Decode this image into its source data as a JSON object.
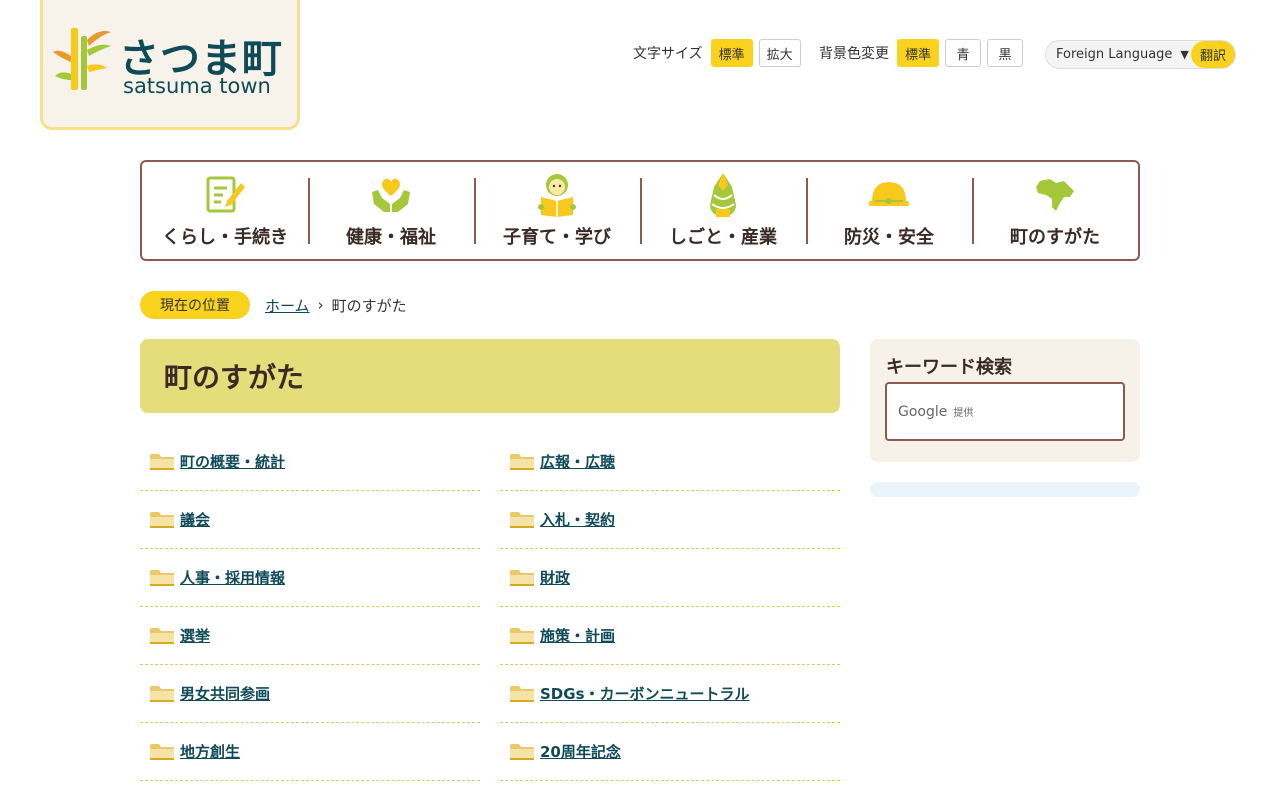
{
  "logo": {
    "ja": "さつま町",
    "en": "satsuma town"
  },
  "utility": {
    "font_size_label": "文字サイズ",
    "font_size_standard": "標準",
    "font_size_large": "拡大",
    "bg_label": "背景色変更",
    "bg_standard": "標準",
    "bg_blue": "青",
    "bg_black": "黒",
    "language_select": "Foreign Language",
    "translate_button": "翻訳"
  },
  "nav": [
    {
      "label": "くらし・手続き",
      "icon": "document-pen-icon"
    },
    {
      "label": "健康・福祉",
      "icon": "heart-hands-icon"
    },
    {
      "label": "子育て・学び",
      "icon": "child-book-icon"
    },
    {
      "label": "しごと・産業",
      "icon": "bamboo-shoot-icon"
    },
    {
      "label": "防災・安全",
      "icon": "helmet-icon"
    },
    {
      "label": "町のすがた",
      "icon": "town-map-icon"
    }
  ],
  "breadcrumb": {
    "label": "現在の位置",
    "home": "ホーム",
    "separator": "›",
    "current": "町のすがた"
  },
  "page_title": "町のすがた",
  "categories_left": [
    {
      "label": "町の概要・統計"
    },
    {
      "label": "議会"
    },
    {
      "label": "人事・採用情報"
    },
    {
      "label": "選挙"
    },
    {
      "label": "男女共同参画"
    },
    {
      "label": "地方創生"
    }
  ],
  "categories_right": [
    {
      "label": "広報・広聴"
    },
    {
      "label": "入札・契約"
    },
    {
      "label": "財政"
    },
    {
      "label": "施策・計画"
    },
    {
      "label": "SDGs・カーボンニュートラル"
    },
    {
      "label": "20周年記念"
    }
  ],
  "sidebar": {
    "search_title": "キーワード検索",
    "google_label": "Google",
    "google_sub": "提供"
  },
  "colors": {
    "accent": "#f8d21c",
    "title_bg": "#e5dc7a",
    "nav_border": "#8b5a52",
    "link": "#0f4a59"
  }
}
